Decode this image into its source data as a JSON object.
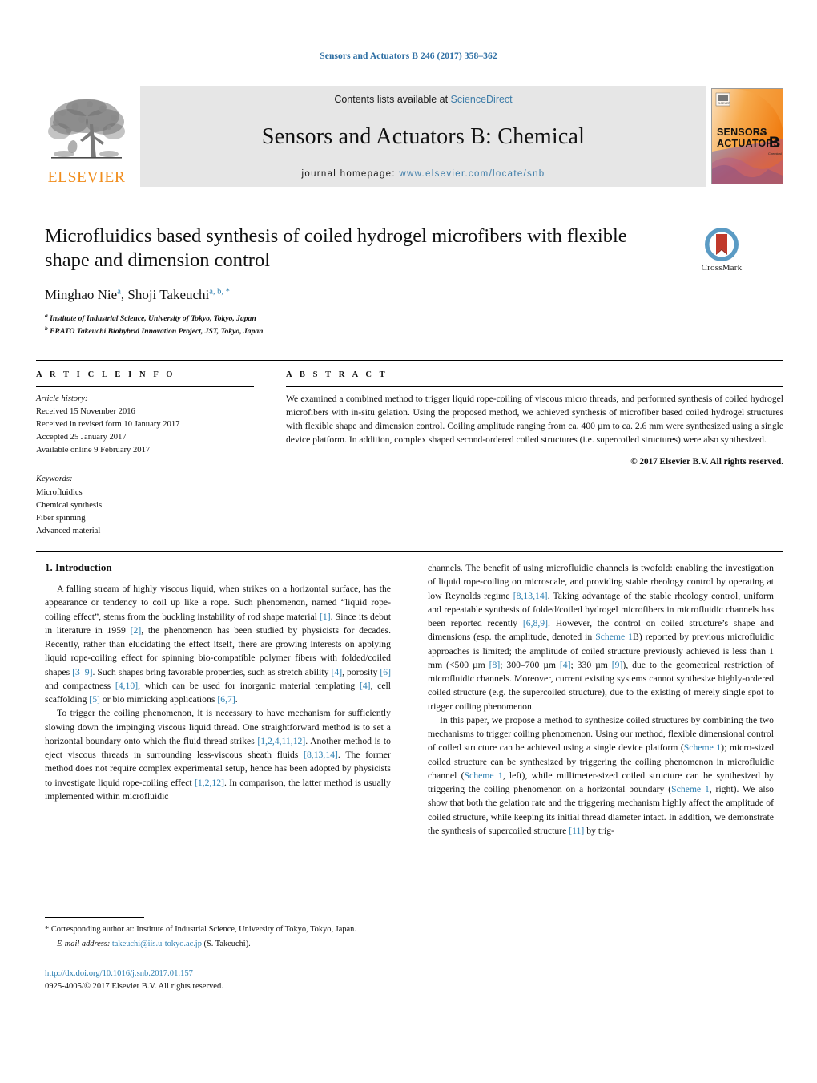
{
  "running_head": "Sensors and Actuators B 246 (2017) 358–362",
  "masthead": {
    "publisher_name": "ELSEVIER",
    "contents_prefix": "Contents lists available at ",
    "contents_link": "ScienceDirect",
    "journal_title": "Sensors and Actuators B: Chemical",
    "homepage_prefix": "journal homepage: ",
    "homepage_url": "www.elsevier.com/locate/snb",
    "cover": {
      "line1": "SENSORS",
      "line1_small": "and",
      "line2": "ACTUATORS",
      "letter": "B",
      "sublabel": "Chemical"
    }
  },
  "title_block": {
    "title": "Microfluidics based synthesis of coiled hydrogel microfibers with flexible shape and dimension control",
    "authors": [
      {
        "name": "Minghao Nie",
        "marks": "a"
      },
      {
        "name": "Shoji Takeuchi",
        "marks": "a, b, *"
      }
    ],
    "affiliations": [
      {
        "mark": "a",
        "text": "Institute of Industrial Science, University of Tokyo, Tokyo, Japan"
      },
      {
        "mark": "b",
        "text": "ERATO Takeuchi Biohybrid Innovation Project, JST, Tokyo, Japan"
      }
    ]
  },
  "crossmark": {
    "label": "CrossMark"
  },
  "article_info": {
    "heading": "A R T I C L E  I N F O",
    "history_label": "Article history:",
    "history": [
      "Received 15 November 2016",
      "Received in revised form 10 January 2017",
      "Accepted 25 January 2017",
      "Available online 9 February 2017"
    ],
    "keywords_label": "Keywords:",
    "keywords": [
      "Microfluidics",
      "Chemical synthesis",
      "Fiber spinning",
      "Advanced material"
    ]
  },
  "abstract": {
    "heading": "A B S T R A C T",
    "text": "We examined a combined method to trigger liquid rope-coiling of viscous micro threads, and performed synthesis of coiled hydrogel microfibers with in-situ gelation. Using the proposed method, we achieved synthesis of microfiber based coiled hydrogel structures with flexible shape and dimension control. Coiling amplitude ranging from ca. 400 µm to ca. 2.6 mm were synthesized using a single device platform. In addition, complex shaped second-ordered coiled structures (i.e. supercoiled structures) were also synthesized.",
    "copyright": "© 2017 Elsevier B.V. All rights reserved."
  },
  "body": {
    "section_heading": "1. Introduction",
    "left_paragraph_1_a": "A falling stream of highly viscous liquid, when strikes on a horizontal surface, has the appearance or tendency to coil up like a rope. Such phenomenon, named “liquid rope-coiling effect”, stems from the buckling instability of rod shape material ",
    "ref_1": "[1]",
    "left_paragraph_1_b": ". Since its debut in literature in 1959 ",
    "ref_2": "[2]",
    "left_paragraph_1_c": ", the phenomenon has been studied by physicists for decades. Recently, rather than elucidating the effect itself, there are growing interests on applying liquid rope-coiling effect for spinning bio-compatible polymer fibers with folded/coiled shapes ",
    "ref_3_9": "[3–9]",
    "left_paragraph_1_d": ". Such shapes bring favorable properties, such as stretch ability ",
    "ref_4": "[4]",
    "left_paragraph_1_e": ", porosity ",
    "ref_6": "[6]",
    "left_paragraph_1_f": " and compactness ",
    "ref_4_10": "[4,10]",
    "left_paragraph_1_g": ", which can be used for inorganic material templating ",
    "ref_4b": "[4]",
    "left_paragraph_1_h": ", cell scaffolding ",
    "ref_5": "[5]",
    "left_paragraph_1_i": " or bio mimicking applications ",
    "ref_6_7": "[6,7]",
    "left_paragraph_1_j": ".",
    "left_paragraph_2_a": "To trigger the coiling phenomenon, it is necessary to have mechanism for sufficiently slowing down the impinging viscous liquid thread. One straightforward method is to set a horizontal boundary onto which the fluid thread strikes ",
    "ref_1_2_4_11_12": "[1,2,4,11,12]",
    "left_paragraph_2_b": ". Another method is to eject viscous threads in surrounding less-viscous sheath fluids ",
    "ref_8_13_14": "[8,13,14]",
    "left_paragraph_2_c": ". The former method does not require complex experimental setup, hence has been adopted by physicists to investigate liquid rope-coiling effect ",
    "ref_1_2_12": "[1,2,12]",
    "left_paragraph_2_d": ". In comparison, the latter method is usually implemented within microfluidic",
    "right_paragraph_1_a": "channels. The benefit of using microfluidic channels is twofold: enabling the investigation of liquid rope-coiling on microscale, and providing stable rheology control by operating at low Reynolds regime ",
    "ref_r8_13_14": "[8,13,14]",
    "right_paragraph_1_b": ". Taking advantage of the stable rheology control, uniform and repeatable synthesis of folded/coiled hydrogel microfibers in microfluidic channels has been reported recently ",
    "ref_6_8_9": "[6,8,9]",
    "right_paragraph_1_c": ". However, the control on coiled structure’s shape and dimensions (esp. the amplitude, denoted in ",
    "scheme_1B": "Scheme 1",
    "right_paragraph_1_d": "B) reported by previous microfluidic approaches is limited; the amplitude of coiled structure previously achieved is less than 1 mm (<500 µm ",
    "ref_8": "[8]",
    "right_paragraph_1_e": "; 300–700 µm ",
    "ref_r4": "[4]",
    "right_paragraph_1_f": "; 330 µm ",
    "ref_9": "[9]",
    "right_paragraph_1_g": "), due to the geometrical restriction of microfluidic channels. Moreover, current existing systems cannot synthesize highly-ordered coiled structure (e.g. the supercoiled structure), due to the existing of merely single spot to trigger coiling phenomenon.",
    "right_paragraph_2_a": "In this paper, we propose a method to synthesize coiled structures by combining the two mechanisms to trigger coiling phenomenon. Using our method, flexible dimensional control of coiled structure can be achieved using a single device platform (",
    "scheme_1_a": "Scheme 1",
    "right_paragraph_2_b": "); micro-sized coiled structure can be synthesized by triggering the coiling phenomenon in microfluidic channel (",
    "scheme_1_b": "Scheme 1",
    "right_paragraph_2_c": ", left), while millimeter-sized coiled structure can be synthesized by triggering the coiling phenomenon on a horizontal boundary (",
    "scheme_1_c": "Scheme 1",
    "right_paragraph_2_d": ", right). We also show that both the gelation rate and the triggering mechanism highly affect the amplitude of coiled structure, while keeping its initial thread diameter intact. In addition, we demonstrate the synthesis of supercoiled structure ",
    "ref_11": "[11]",
    "right_paragraph_2_e": " by trig-"
  },
  "footnotes": {
    "corresponding_star": "*",
    "corresponding_text": "Corresponding author at: Institute of Industrial Science, University of Tokyo, Tokyo, Japan.",
    "email_label": "E-mail address:",
    "email": "takeuchi@iis.u-tokyo.ac.jp",
    "email_owner": "(S. Takeuchi).",
    "doi": "http://dx.doi.org/10.1016/j.snb.2017.01.157",
    "issn_line": "0925-4005/© 2017 Elsevier B.V. All rights reserved."
  },
  "colors": {
    "link_blue": "#2d7fb0",
    "sciencedirect_blue": "#3d7ca8",
    "elsevier_orange": "#f08c1b",
    "banner_grey": "#e6e6e6",
    "crossmark_blue": "#5b9bc4",
    "crossmark_red": "#c0392b"
  }
}
